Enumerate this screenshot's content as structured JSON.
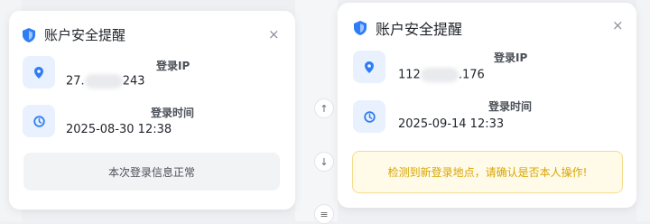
{
  "colors": {
    "accent": "#2f7df6",
    "icon_bg": "#e8f1fd",
    "warning_bg": "#fffbe8",
    "warning_border": "#f5dc8c",
    "warning_text": "#d9a400",
    "neutral_bg": "#f2f3f5"
  },
  "mid_buttons": [
    "↑",
    "↓",
    "≡"
  ],
  "left_card": {
    "title": "账户安全提醒",
    "close_label": "×",
    "icons": {
      "title": "shield-icon",
      "ip": "location-pin-icon",
      "time": "clock-icon"
    },
    "ip_label": "登录IP",
    "ip_prefix": "27.",
    "ip_suffix": "243",
    "time_label": "登录时间",
    "time_value": "2025-08-30 12:38",
    "status": "本次登录信息正常"
  },
  "right_card": {
    "title": "账户安全提醒",
    "close_label": "×",
    "icons": {
      "title": "shield-icon",
      "ip": "location-pin-icon",
      "time": "clock-icon"
    },
    "ip_label": "登录IP",
    "ip_prefix": "112",
    "ip_suffix": ".176",
    "time_label": "登录时间",
    "time_value": "2025-09-14 12:33",
    "warning": "检测到新登录地点，请确认是否本人操作!"
  }
}
